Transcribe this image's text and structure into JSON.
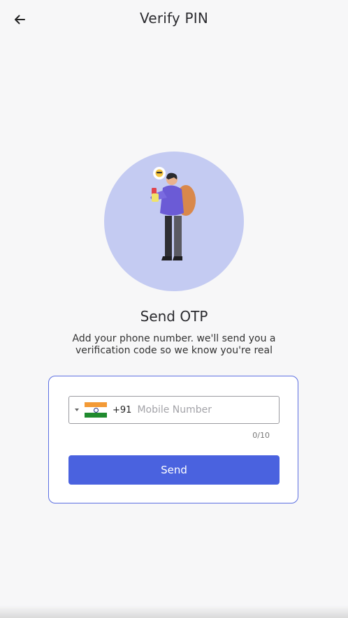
{
  "header": {
    "title": "Verify PIN",
    "back_icon": "arrow-left-icon"
  },
  "illustration": {
    "name": "person-with-phone-illustration",
    "circle_color": "#c4cbf2"
  },
  "content": {
    "heading": "Send OTP",
    "subtitle": "Add your phone number. we'll send you a verification code so we know you're real"
  },
  "form": {
    "country_code": "+91",
    "country_flag": "india-flag-icon",
    "phone_placeholder": "Mobile Number",
    "phone_value": "",
    "char_counter": "0/10",
    "send_label": "Send"
  },
  "colors": {
    "accent": "#4a62df",
    "card_border": "#5b6ee1",
    "background": "#f7f7f8"
  }
}
